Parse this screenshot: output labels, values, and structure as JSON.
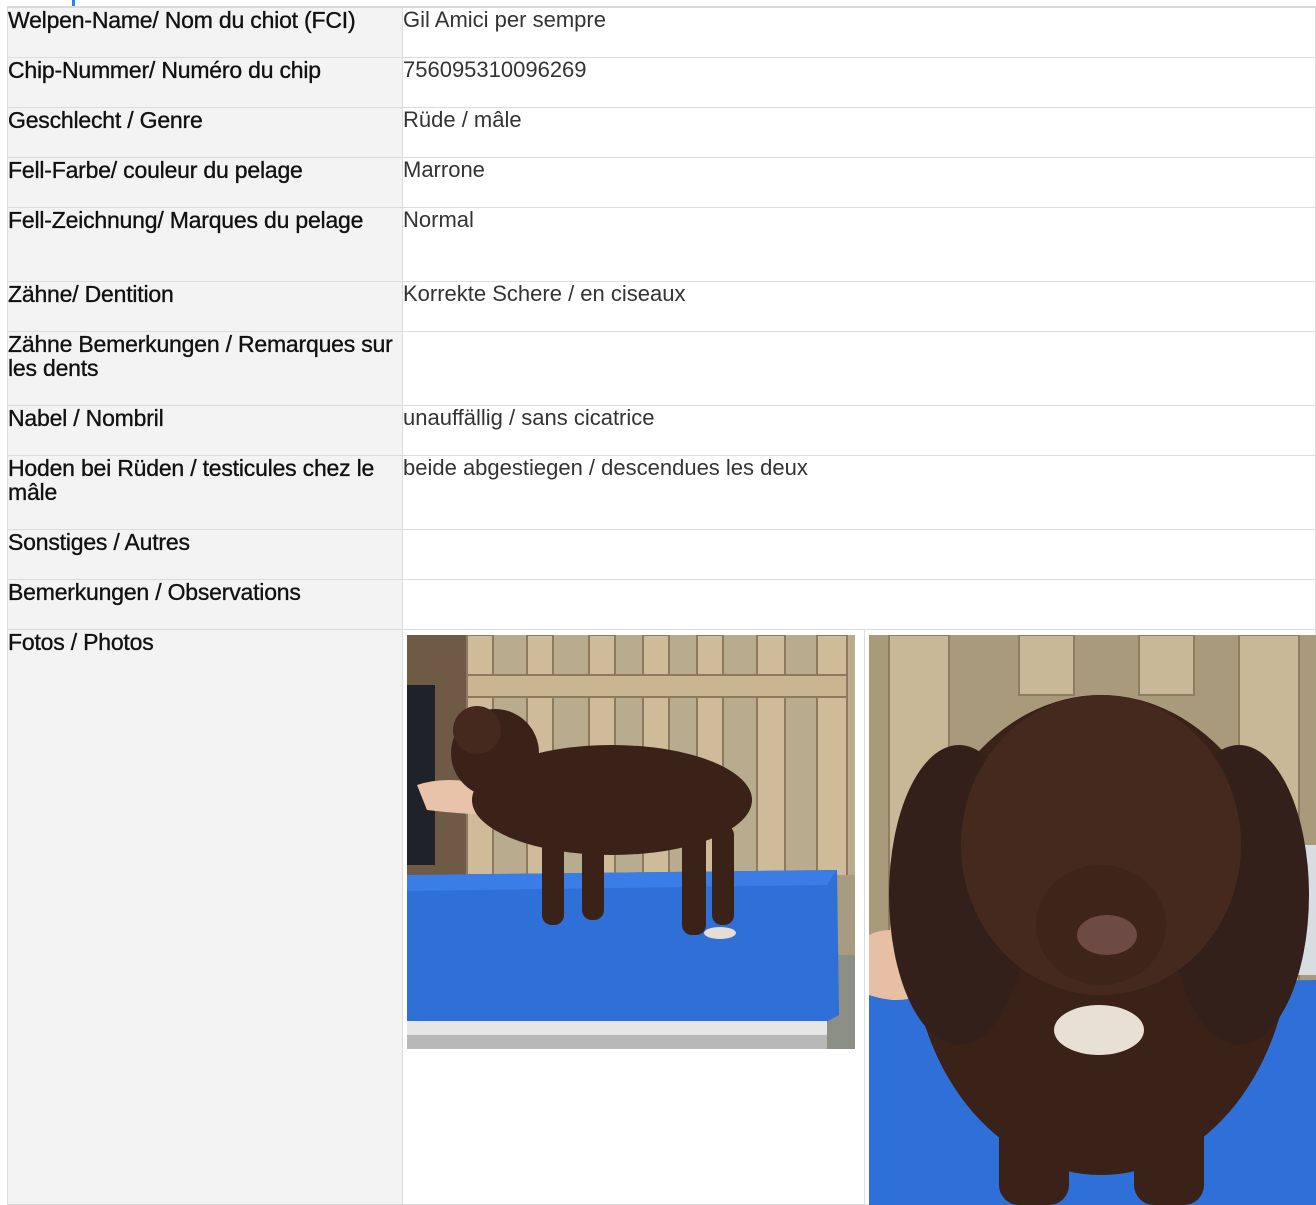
{
  "colors": {
    "accent": "#1e88e5",
    "label_bg": "#f3f3f3",
    "table_blue": "#2f6fd8",
    "dog_brown": "#3a2219"
  },
  "rows": [
    {
      "label": "Welpen-Name/ Nom du chiot (FCI)",
      "value": "Gil Amici per sempre"
    },
    {
      "label": "Chip-Nummer/ Numéro du chip",
      "value": "756095310096269"
    },
    {
      "label": "Geschlecht / Genre",
      "value": "Rüde / mâle"
    },
    {
      "label": "Fell-Farbe/ couleur du pelage",
      "value": "Marrone"
    },
    {
      "label": "Fell-Zeichnung/ Marques du pelage",
      "value": "Normal"
    },
    {
      "label": "Zähne/ Dentition",
      "value": "Korrekte Schere / en ciseaux"
    },
    {
      "label": "Zähne Bemerkungen / Remarques sur les dents",
      "value": ""
    },
    {
      "label": "Nabel / Nombril",
      "value": "unauffällig / sans cicatrice"
    },
    {
      "label": "Hoden bei Rüden / testicules chez le mâle",
      "value": "beide abgestiegen / descendues les deux"
    },
    {
      "label": "Sonstiges / Autres",
      "value": ""
    },
    {
      "label": "Bemerkungen / Observations",
      "value": ""
    },
    {
      "label": "Fotos / Photos"
    }
  ],
  "photos": [
    {
      "icon": "puppy-side-photo"
    },
    {
      "icon": "puppy-face-photo"
    }
  ]
}
